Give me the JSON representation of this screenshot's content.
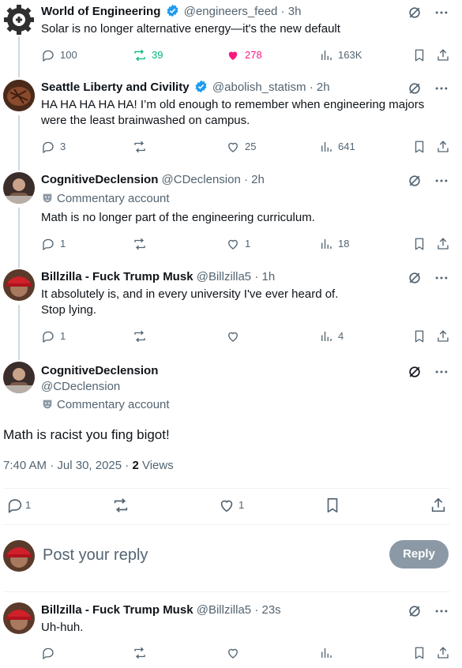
{
  "posts": [
    {
      "author": "World of Engineering",
      "handle": "@engineers_feed",
      "time": "3h",
      "verified": true,
      "text": "Solar is no longer alternative energy—it's the new default",
      "replies": "100",
      "reposts": "39",
      "likes": "278",
      "views": "163K",
      "reposted": true,
      "liked": true
    },
    {
      "author": "Seattle Liberty and Civility",
      "handle": "@abolish_statism",
      "time": "2h",
      "verified": true,
      "text_line1": "HA HA HA HA HA!  I’m old enough to remember when engineering majors",
      "text_line2": "were the least brainwashed on campus.",
      "replies": "3",
      "reposts": "",
      "likes": "25",
      "views": "641"
    },
    {
      "author": "CognitiveDeclension",
      "handle": "@CDeclension",
      "time": "2h",
      "context": "Commentary account",
      "text": "Math is no longer part of the engineering curriculum.",
      "replies": "1",
      "reposts": "",
      "likes": "1",
      "views": "18"
    },
    {
      "author": "Billzilla - Fuck Trump Musk",
      "handle": "@Billzilla5",
      "time": "1h",
      "text_line1": "It absolutely is, and in every university I've ever heard of.",
      "text_line2": "Stop lying.",
      "replies": "1",
      "reposts": "",
      "likes": "",
      "views": "4"
    }
  ],
  "main": {
    "author": "CognitiveDeclension",
    "handle": "@CDeclension",
    "context": "Commentary account",
    "text": "Math is racist you fing bigot!",
    "time": "7:40 AM",
    "date": "Jul 30, 2025",
    "views_count": "2",
    "views_label": "Views",
    "replies": "1",
    "likes": "1"
  },
  "reply_box": {
    "placeholder": "Post your reply",
    "button": "Reply"
  },
  "last_reply": {
    "author": "Billzilla - Fuck Trump Musk",
    "handle": "@Billzilla5",
    "time": "23s",
    "text": "Uh-huh."
  },
  "colors": {
    "accent_blue": "#1d9bf0",
    "repost_green": "#00ba7c",
    "like_pink": "#f91880",
    "muted": "#536471"
  },
  "icons": [
    "gear-logo-icon",
    "verified-badge-icon",
    "grok-icon",
    "more-icon",
    "reply-icon",
    "repost-icon",
    "like-icon",
    "views-icon",
    "bookmark-icon",
    "share-icon",
    "mask-icon"
  ]
}
